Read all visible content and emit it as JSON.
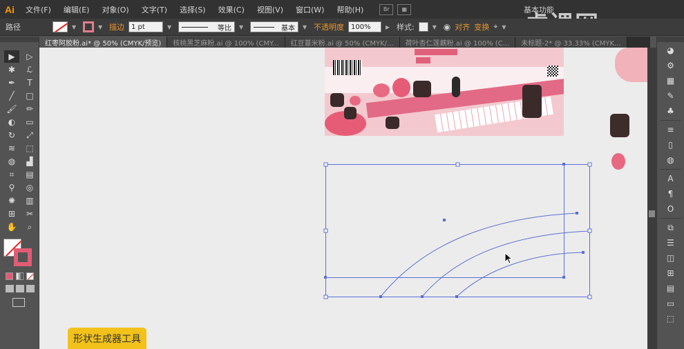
{
  "app": {
    "logo": "Ai"
  },
  "menu": [
    "文件(F)",
    "编辑(E)",
    "对象(O)",
    "文字(T)",
    "选择(S)",
    "效果(C)",
    "视图(V)",
    "窗口(W)",
    "帮助(H)"
  ],
  "menu_icons": {
    "bridge": "Br",
    "arrange": "▦"
  },
  "workspace_label": "基本功能",
  "brand_watermark": "虎课网",
  "control": {
    "path_label": "路径",
    "stroke_label": "描边",
    "stroke_weight": "1 pt",
    "profile_label": "等比",
    "brush_label": "基本",
    "opacity_label": "不透明度",
    "opacity_value": "100%",
    "style_label": "样式:",
    "align_label": "对齐",
    "transform_label": "变换"
  },
  "tabs": [
    {
      "label": "红枣阿胶粉.ai* @ 50% (CMYK/预览)",
      "active": true
    },
    {
      "label": "核桃黑芝麻粉.ai @ 100% (CMY...",
      "active": false
    },
    {
      "label": "红豆薏米粉.ai @ 50% (CMYK/...",
      "active": false
    },
    {
      "label": "荷叶杏仁莲藕粉.ai @ 100% (C...",
      "active": false
    },
    {
      "label": "未标题-2* @ 33.33% (CMYK...",
      "active": false
    }
  ],
  "tools": [
    [
      "selection-tool",
      "▶"
    ],
    [
      "direct-selection-tool",
      "▷"
    ],
    [
      "magic-wand-tool",
      "✱"
    ],
    [
      "lasso-tool",
      "ℒ"
    ],
    [
      "pen-tool",
      "✒"
    ],
    [
      "type-tool",
      "T"
    ],
    [
      "line-tool",
      "╱"
    ],
    [
      "rectangle-tool",
      "□"
    ],
    [
      "paintbrush-tool",
      "🖌"
    ],
    [
      "pencil-tool",
      "✏"
    ],
    [
      "blob-brush-tool",
      "◐"
    ],
    [
      "eraser-tool",
      "▭"
    ],
    [
      "rotate-tool",
      "↻"
    ],
    [
      "scale-tool",
      "⤢"
    ],
    [
      "width-tool",
      "≋"
    ],
    [
      "free-transform-tool",
      "⬚"
    ],
    [
      "shape-builder-tool",
      "◍"
    ],
    [
      "perspective-grid-tool",
      "▟"
    ],
    [
      "mesh-tool",
      "⌗"
    ],
    [
      "gradient-tool",
      "▤"
    ],
    [
      "eyedropper-tool",
      "⚲"
    ],
    [
      "blend-tool",
      "◎"
    ],
    [
      "symbol-sprayer-tool",
      "✺"
    ],
    [
      "column-graph-tool",
      "▥"
    ],
    [
      "artboard-tool",
      "⊞"
    ],
    [
      "slice-tool",
      "✂"
    ],
    [
      "hand-tool",
      "✋"
    ],
    [
      "zoom-tool",
      "⌕"
    ]
  ],
  "right_panel_icons": [
    "color-icon",
    "color-guide-icon",
    "swatches-icon",
    "brushes-icon",
    "symbols-icon",
    "stroke-icon",
    "gradient-icon",
    "transparency-icon",
    "character-icon",
    "paragraph-icon",
    "opentype-icon",
    "links-icon",
    "align-icon",
    "pathfinder-icon",
    "transform-icon",
    "layers-icon",
    "artboards-icon",
    "asset-export-icon"
  ],
  "colors": {
    "accent_orange": "#e8932c",
    "stroke_pink": "#e05c74",
    "selection_blue": "#5b6fd6",
    "tooltip_yellow": "#f2c21b"
  },
  "tooltip_text": "形状生成器工具"
}
